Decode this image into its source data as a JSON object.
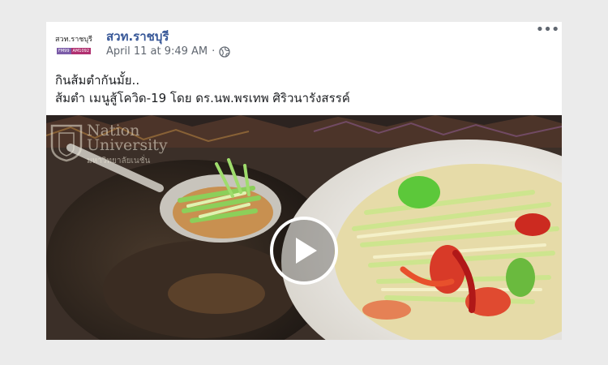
{
  "post": {
    "page_name": "สวท.ราชบุรี",
    "avatar": {
      "title": "สวท.ราชบุรี",
      "chips": [
        "FM99",
        "AM1092"
      ]
    },
    "timestamp": "April 11 at 9:49 AM",
    "separator": "·",
    "more_label": "•••",
    "text_lines": [
      "กินส้มตำกันมั้ย..",
      "ส้มตำ เมนูสู้โควิด-19 โดย ดร.นพ.พรเทพ ศิริวนารังสรรค์"
    ]
  },
  "video": {
    "watermark": {
      "line1": "Nation",
      "line2": "University",
      "line3": "มหาวิทยาลัยเนชั่น"
    },
    "icons": {
      "play": "play-icon",
      "globe": "globe-icon",
      "more": "more-options-icon"
    }
  }
}
